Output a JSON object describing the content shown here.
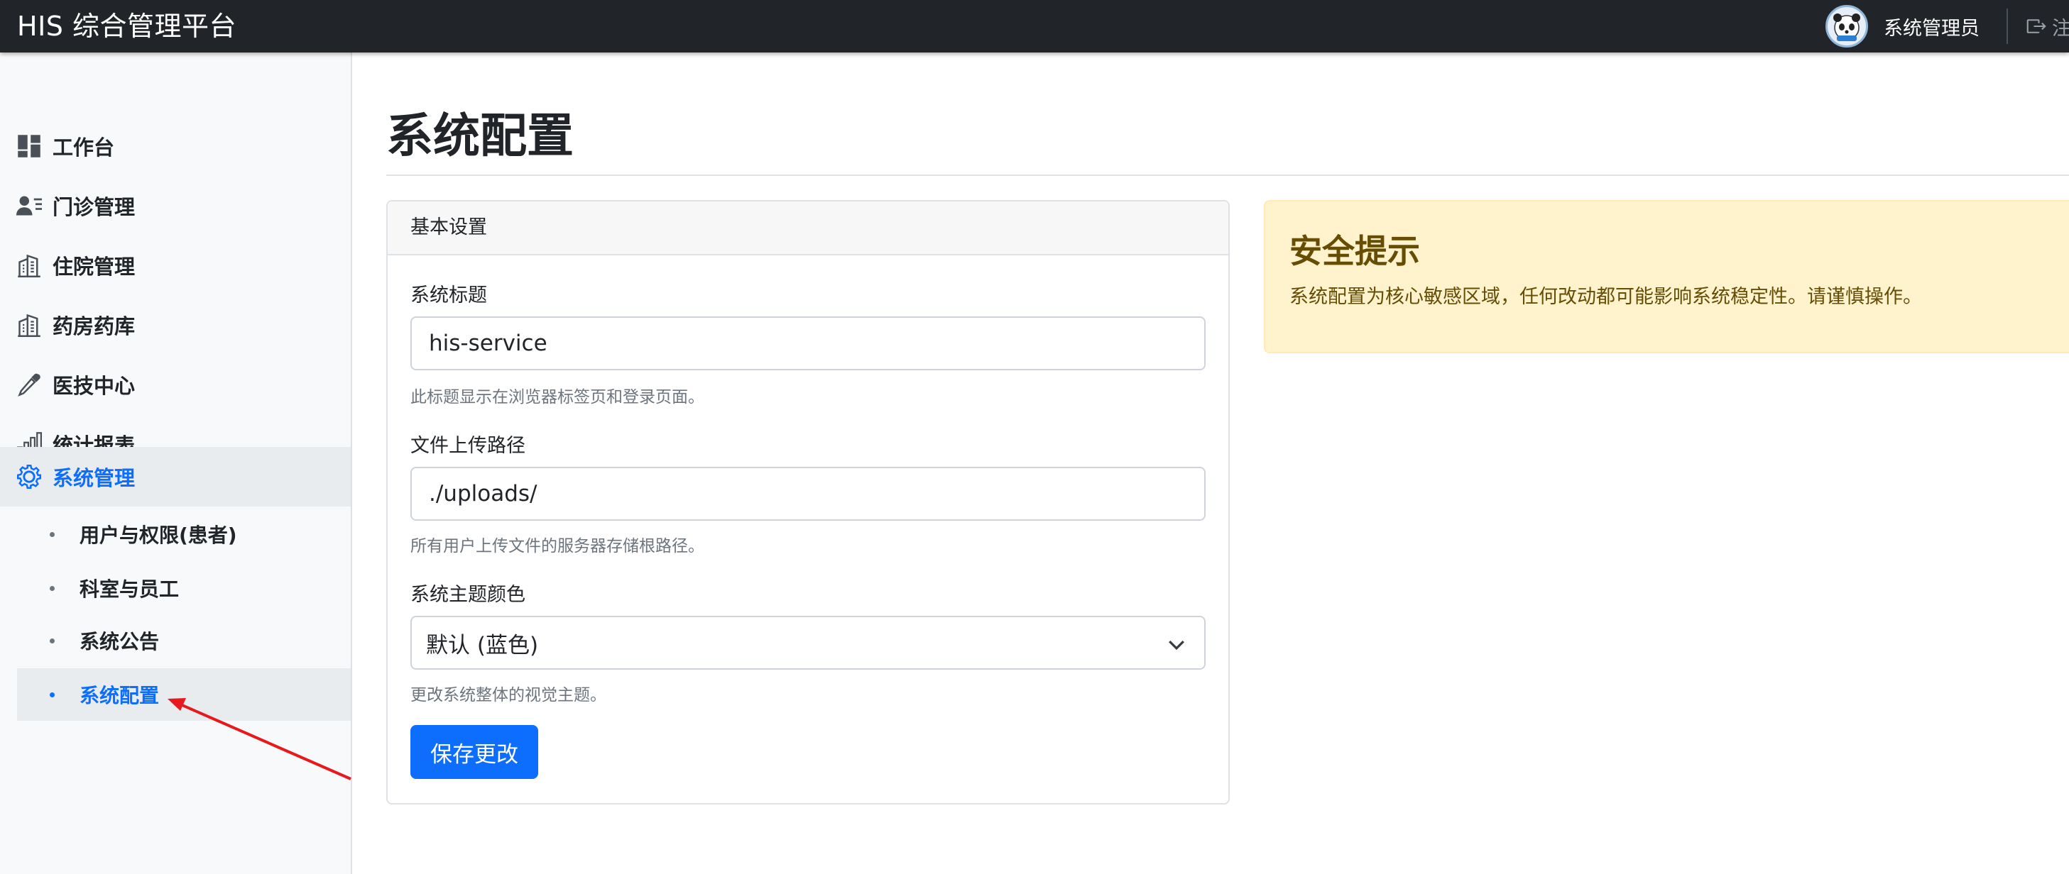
{
  "app": {
    "brand": "HIS 综合管理平台",
    "user_name": "系统管理员",
    "logout_label": "注销"
  },
  "sidebar": {
    "items": [
      {
        "label": "工作台",
        "icon": "dashboard-icon"
      },
      {
        "label": "门诊管理",
        "icon": "person-lines-icon"
      },
      {
        "label": "住院管理",
        "icon": "building-icon"
      },
      {
        "label": "药房药库",
        "icon": "building-icon"
      },
      {
        "label": "医技中心",
        "icon": "eyedropper-icon"
      },
      {
        "label": "统计报表",
        "icon": "bar-chart-icon"
      },
      {
        "label": "系统管理",
        "icon": "gear-icon",
        "active": true
      }
    ],
    "sub_items": [
      {
        "label": "用户与权限(患者)"
      },
      {
        "label": "科室与员工"
      },
      {
        "label": "系统公告"
      },
      {
        "label": "系统配置",
        "active": true
      }
    ]
  },
  "main": {
    "title": "系统配置",
    "card": {
      "header": "基本设置",
      "fields": {
        "title_label": "系统标题",
        "title_value": "his-service",
        "title_help": "此标题显示在浏览器标签页和登录页面。",
        "path_label": "文件上传路径",
        "path_value": "./uploads/",
        "path_help": "所有用户上传文件的服务器存储根路径。",
        "theme_label": "系统主题颜色",
        "theme_value": "默认 (蓝色)",
        "theme_help": "更改系统整体的视觉主题。"
      },
      "save_label": "保存更改"
    },
    "alert": {
      "title": "安全提示",
      "text": "系统配置为核心敏感区域，任何改动都可能影响系统稳定性。请谨慎操作。"
    }
  },
  "colors": {
    "navbar": "#212529",
    "primary": "#0d6efd",
    "warning_bg": "#fff3cd",
    "warning_text": "#664d03",
    "annotation": "#e8191c"
  }
}
